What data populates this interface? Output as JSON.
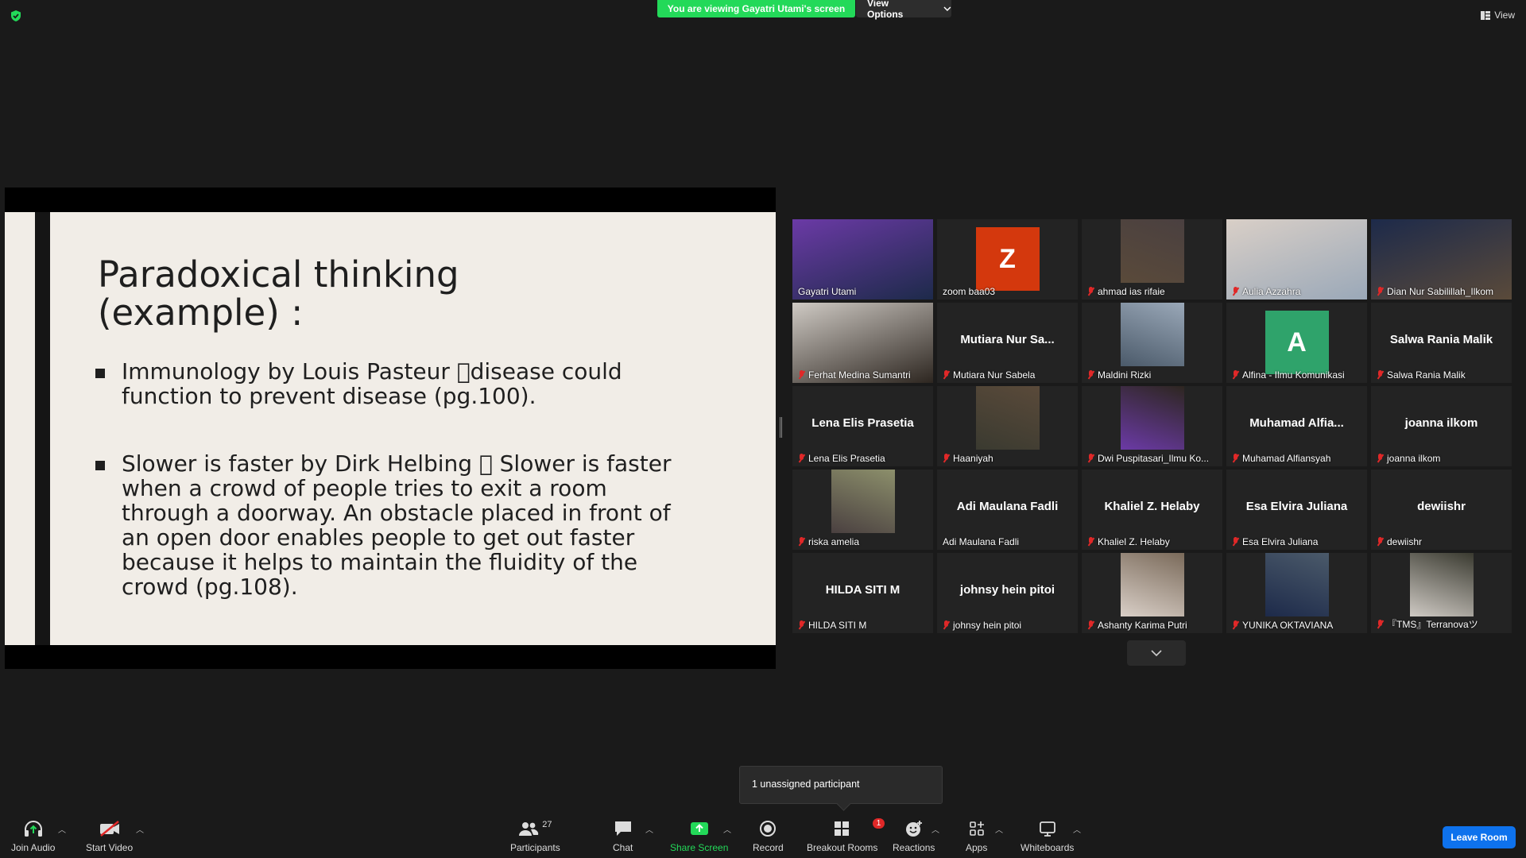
{
  "top_bar": {
    "viewing_banner_prefix": "You are viewing",
    "viewing_banner_name": "Gayatri Utami's screen",
    "view_options_label": "View Options",
    "view_label": "View"
  },
  "slide": {
    "title_line1": "Paradoxical thinking",
    "title_line2": "(example) :",
    "bullet1": "Immunology by Louis Pasteur disease could function to prevent disease (pg.100).",
    "bullet2": "Slower is faster by Dirk Helbing  Slower is faster when a crowd of people tries to exit a room through a doorway.  An obstacle placed in front of an open door enables people to get out faster because it helps to maintain the fluidity of the crowd  (pg.108)."
  },
  "participants": [
    {
      "name": "Gayatri Utami",
      "muted": false,
      "type": "video",
      "active": true
    },
    {
      "name": "zoom baa03",
      "muted": false,
      "type": "avatar",
      "initial": "Z",
      "color": "#d4380d"
    },
    {
      "name": "ahmad ias rifaie",
      "muted": true,
      "type": "photo"
    },
    {
      "name": "Aulia Azzahra",
      "muted": true,
      "type": "video"
    },
    {
      "name": "Dian Nur Sabilillah_Ilkom",
      "muted": true,
      "type": "video"
    },
    {
      "name": "Ferhat Medina Sumantri",
      "muted": true,
      "type": "video"
    },
    {
      "name": "Mutiara Nur Sabela",
      "display": "Mutiara  Nur  Sa...",
      "muted": true,
      "type": "text"
    },
    {
      "name": "Maldini Rizki",
      "muted": true,
      "type": "photo"
    },
    {
      "name": "Alfina - Ilmu Komunikasi",
      "muted": true,
      "type": "avatar",
      "initial": "A",
      "color": "#2fa36b"
    },
    {
      "name": "Salwa Rania Malik",
      "display": "Salwa Rania Malik",
      "muted": true,
      "type": "text"
    },
    {
      "name": "Lena Elis Prasetia",
      "display": "Lena Elis Prasetia",
      "muted": true,
      "type": "text"
    },
    {
      "name": "Haaniyah",
      "muted": true,
      "type": "photo"
    },
    {
      "name": "Dwi Puspitasari_Ilmu Ko...",
      "muted": true,
      "type": "photo"
    },
    {
      "name": "Muhamad Alfiansyah",
      "display": "Muhamad  Alfia...",
      "muted": true,
      "type": "text"
    },
    {
      "name": "joanna ilkom",
      "display": "joanna ilkom",
      "muted": true,
      "type": "text"
    },
    {
      "name": "riska amelia",
      "muted": true,
      "type": "photo"
    },
    {
      "name": "Adi Maulana Fadli",
      "display": "Adi Maulana Fadli",
      "muted": false,
      "type": "text"
    },
    {
      "name": "Khaliel Z. Helaby",
      "display": "Khaliel Z. Helaby",
      "muted": true,
      "type": "text"
    },
    {
      "name": "Esa Elvira Juliana",
      "display": "Esa Elvira Juliana",
      "muted": true,
      "type": "text"
    },
    {
      "name": "dewiishr",
      "display": "dewiishr",
      "muted": true,
      "type": "text"
    },
    {
      "name": "HILDA SITI M",
      "display": "HILDA SITI M",
      "muted": true,
      "type": "text"
    },
    {
      "name": "johnsy hein pitoi",
      "display": "johnsy hein pitoi",
      "muted": true,
      "type": "text"
    },
    {
      "name": "Ashanty Karima Putri",
      "muted": true,
      "type": "photo"
    },
    {
      "name": "YUNIKA OKTAVIANA",
      "muted": true,
      "type": "photo"
    },
    {
      "name": "『TMS』Terranovaツ",
      "muted": true,
      "type": "photo"
    }
  ],
  "popup": {
    "unassigned": "1 unassigned participant"
  },
  "toolbar": {
    "join_audio": "Join Audio",
    "start_video": "Start Video",
    "participants": "Participants",
    "participants_count": "27",
    "chat": "Chat",
    "share_screen": "Share Screen",
    "record": "Record",
    "breakout_rooms": "Breakout Rooms",
    "breakout_badge": "1",
    "reactions": "Reactions",
    "apps": "Apps",
    "whiteboards": "Whiteboards",
    "leave_room": "Leave Room"
  },
  "colors": {
    "banner_green": "#23d959",
    "active_outline": "#b6d71c",
    "leave_blue": "#0e72ed",
    "mute_red": "#e02828"
  }
}
